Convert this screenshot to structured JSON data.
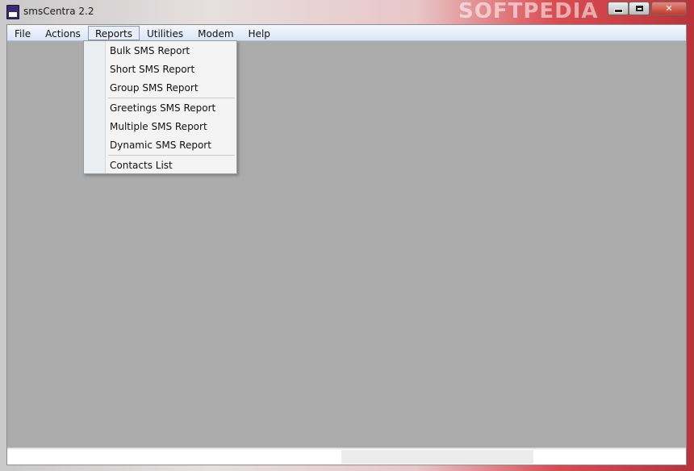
{
  "window": {
    "title": "smsCentra 2.2",
    "watermark": "SOFTPEDIA",
    "colors": {
      "client_bg": "#ababab",
      "close_button": "#c1392c"
    }
  },
  "menubar": {
    "items": [
      {
        "label": "File"
      },
      {
        "label": "Actions"
      },
      {
        "label": "Reports"
      },
      {
        "label": "Utilities"
      },
      {
        "label": "Modem"
      },
      {
        "label": "Help"
      }
    ],
    "open_menu": "Reports"
  },
  "reports_menu": {
    "items": [
      {
        "label": "Bulk SMS Report"
      },
      {
        "label": "Short SMS Report"
      },
      {
        "label": "Group SMS Report"
      },
      {
        "label": "Greetings SMS Report"
      },
      {
        "label": "Multiple SMS Report"
      },
      {
        "label": "Dynamic SMS Report"
      },
      {
        "label": "Contacts List"
      }
    ]
  },
  "icons": {
    "app": "sms-app-icon",
    "minimize": "minimize-icon",
    "maximize": "maximize-icon",
    "close": "close-icon"
  }
}
